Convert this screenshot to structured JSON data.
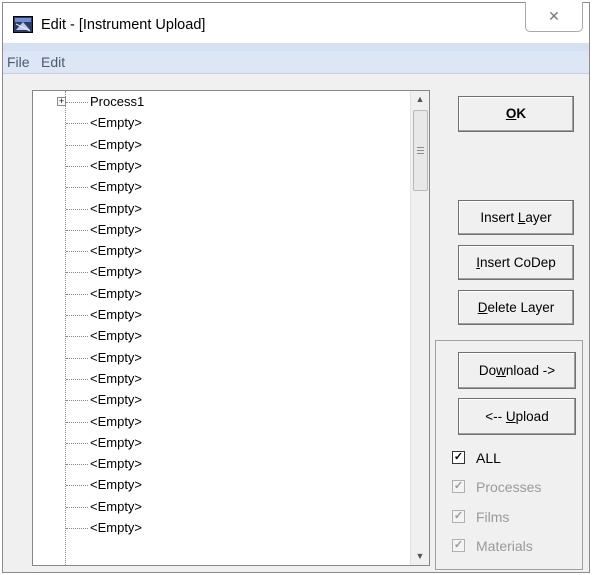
{
  "window": {
    "title": "Edit - [Instrument Upload]",
    "close_glyph": "✕"
  },
  "menu": {
    "items": [
      "File",
      "Edit"
    ]
  },
  "tree": {
    "root_label": "Process1",
    "expander": "+",
    "empty_label": "<Empty>",
    "empty_count": 20
  },
  "buttons": {
    "ok": {
      "pre": "",
      "u": "O",
      "post": "K"
    },
    "insert_layer": {
      "pre": "Insert ",
      "u": "L",
      "post": "ayer"
    },
    "insert_codep": {
      "pre": "",
      "u": "I",
      "post": "nsert CoDep"
    },
    "delete_layer": {
      "pre": "",
      "u": "D",
      "post": "elete Layer"
    },
    "download": {
      "pre": "Do",
      "u": "w",
      "post": "nload ->"
    },
    "upload": {
      "pre": "<-- ",
      "u": "U",
      "post": "pload"
    }
  },
  "checkboxes": [
    {
      "label": "ALL",
      "checked": true,
      "enabled": true
    },
    {
      "label": "Processes",
      "checked": true,
      "enabled": false
    },
    {
      "label": "Films",
      "checked": true,
      "enabled": false
    },
    {
      "label": "Materials",
      "checked": true,
      "enabled": false
    }
  ]
}
